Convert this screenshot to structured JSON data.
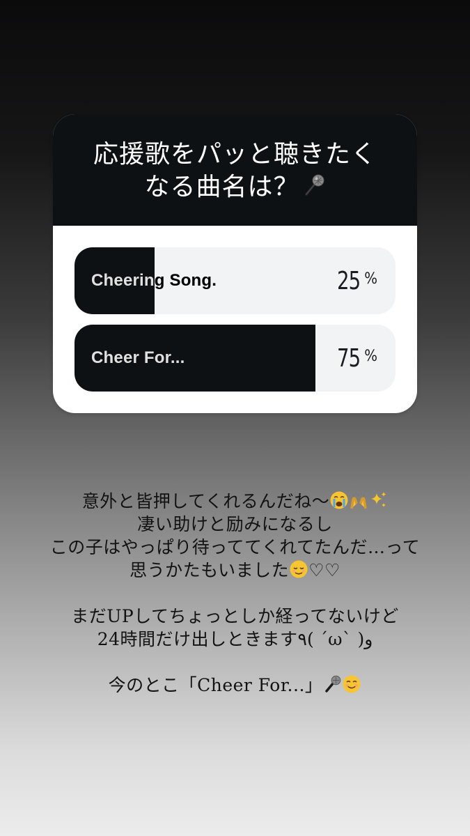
{
  "poll": {
    "question_line1": "応援歌をパッと聴きたく",
    "question_line2": "なる曲名は？",
    "options": [
      {
        "label": "Cheering Song.",
        "percent": "25",
        "percent_symbol": "%",
        "fill_fraction": 0.25
      },
      {
        "label": "Cheer For...",
        "percent": "75",
        "percent_symbol": "%",
        "fill_fraction": 0.75
      }
    ]
  },
  "caption": {
    "line1": "意外と皆押してくれるんだね〜",
    "line2": "凄い助けと励みになるし",
    "line3": "この子はやっぱり待っててくれてたんだ…って",
    "line4": "思うかたもいました",
    "line4_hearts": "♡♡",
    "line5": "まだUPしてちょっとしか経ってないけど",
    "line6": "24時間だけ出しときます٩( ´ω` )و",
    "line7": "今のとこ「Cheer For...」"
  },
  "icons": {
    "question_icon": "microphone-icon",
    "line1_icons": [
      "crying-face-icon",
      "raising-hands-icon",
      "sparkles-icon"
    ],
    "line4_icon": "relieved-face-icon",
    "line7_icons": [
      "microphone-icon",
      "smiling-face-icon"
    ]
  },
  "colors": {
    "poll_dark": "#0e1114",
    "poll_light": "#f2f3f5",
    "caption_text": "#121212"
  }
}
